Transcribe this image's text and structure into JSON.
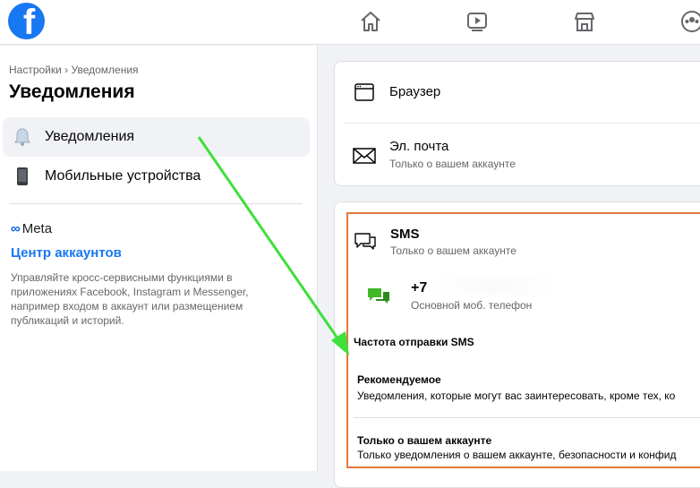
{
  "topbar": {
    "logo_letter": "f",
    "nav_icons": [
      "home-icon",
      "video-icon",
      "marketplace-icon",
      "groups-icon"
    ]
  },
  "sidebar": {
    "breadcrumb": "Настройки › Уведомления",
    "title": "Уведомления",
    "items": [
      {
        "label": "Уведомления",
        "icon": "bell-icon",
        "active": true
      },
      {
        "label": "Мобильные устройства",
        "icon": "phone-icon",
        "active": false
      }
    ],
    "meta_label": "Meta",
    "accounts_center": "Центр аккаунтов",
    "accounts_desc": "Управляйте кросс-сервисными функциями в приложениях Facebook, Instagram и Messenger, например входом в аккаунт или размещением публикаций и историй."
  },
  "main": {
    "channels": [
      {
        "title": "Браузер",
        "subtitle": "",
        "icon": "browser-icon"
      },
      {
        "title": "Эл. почта",
        "subtitle": "Только о вашем аккаунте",
        "icon": "mail-icon"
      }
    ],
    "sms": {
      "title": "SMS",
      "subtitle": "Только о вашем аккаунте",
      "phone": "+7",
      "phone_sub": "Основной моб. телефон",
      "frequency_label": "Частота отправки SMS",
      "options": [
        {
          "title": "Рекомендуемое",
          "desc": "Уведомления, которые могут вас заинтересовать, кроме тех, ко"
        },
        {
          "title": "Только о вашем аккаунте",
          "desc": "Только уведомления о вашем аккаунте, безопасности и конфид"
        }
      ]
    }
  },
  "colors": {
    "accent": "#1877f2",
    "highlight_border": "#e07a3b",
    "annotation_arrow": "#3ee03a"
  }
}
